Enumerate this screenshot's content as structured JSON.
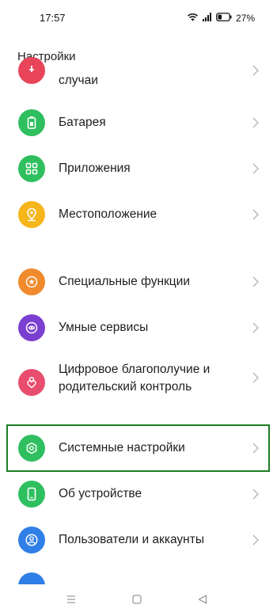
{
  "status": {
    "time": "17:57",
    "battery": "27%"
  },
  "header": {
    "title": "Настройки"
  },
  "rows": [
    {
      "label": "случаи",
      "color": "#e8455a",
      "icon": "emergency-icon"
    },
    {
      "label": "Батарея",
      "color": "#2fbf5f",
      "icon": "battery-icon"
    },
    {
      "label": "Приложения",
      "color": "#2fbf5f",
      "icon": "apps-grid-icon"
    },
    {
      "label": "Местоположение",
      "color": "#f6b51a",
      "icon": "location-pin-icon"
    },
    {
      "label": "Специальные функции",
      "color": "#f08a2c",
      "icon": "accessibility-star-icon"
    },
    {
      "label": "Умные сервисы",
      "color": "#7b3fd1",
      "icon": "smart-services-icon"
    },
    {
      "label_line1": "Цифровое благополучие и",
      "label_line2": "родительский контроль",
      "color": "#e84d6e",
      "icon": "wellbeing-heart-icon"
    },
    {
      "label": "Системные настройки",
      "color": "#2fbf5f",
      "icon": "system-hexagon-icon"
    },
    {
      "label": "Об устройстве",
      "color": "#2fbf5f",
      "icon": "phone-device-icon"
    },
    {
      "label": "Пользователи и аккаунты",
      "color": "#2f7fe6",
      "icon": "user-account-icon"
    }
  ]
}
